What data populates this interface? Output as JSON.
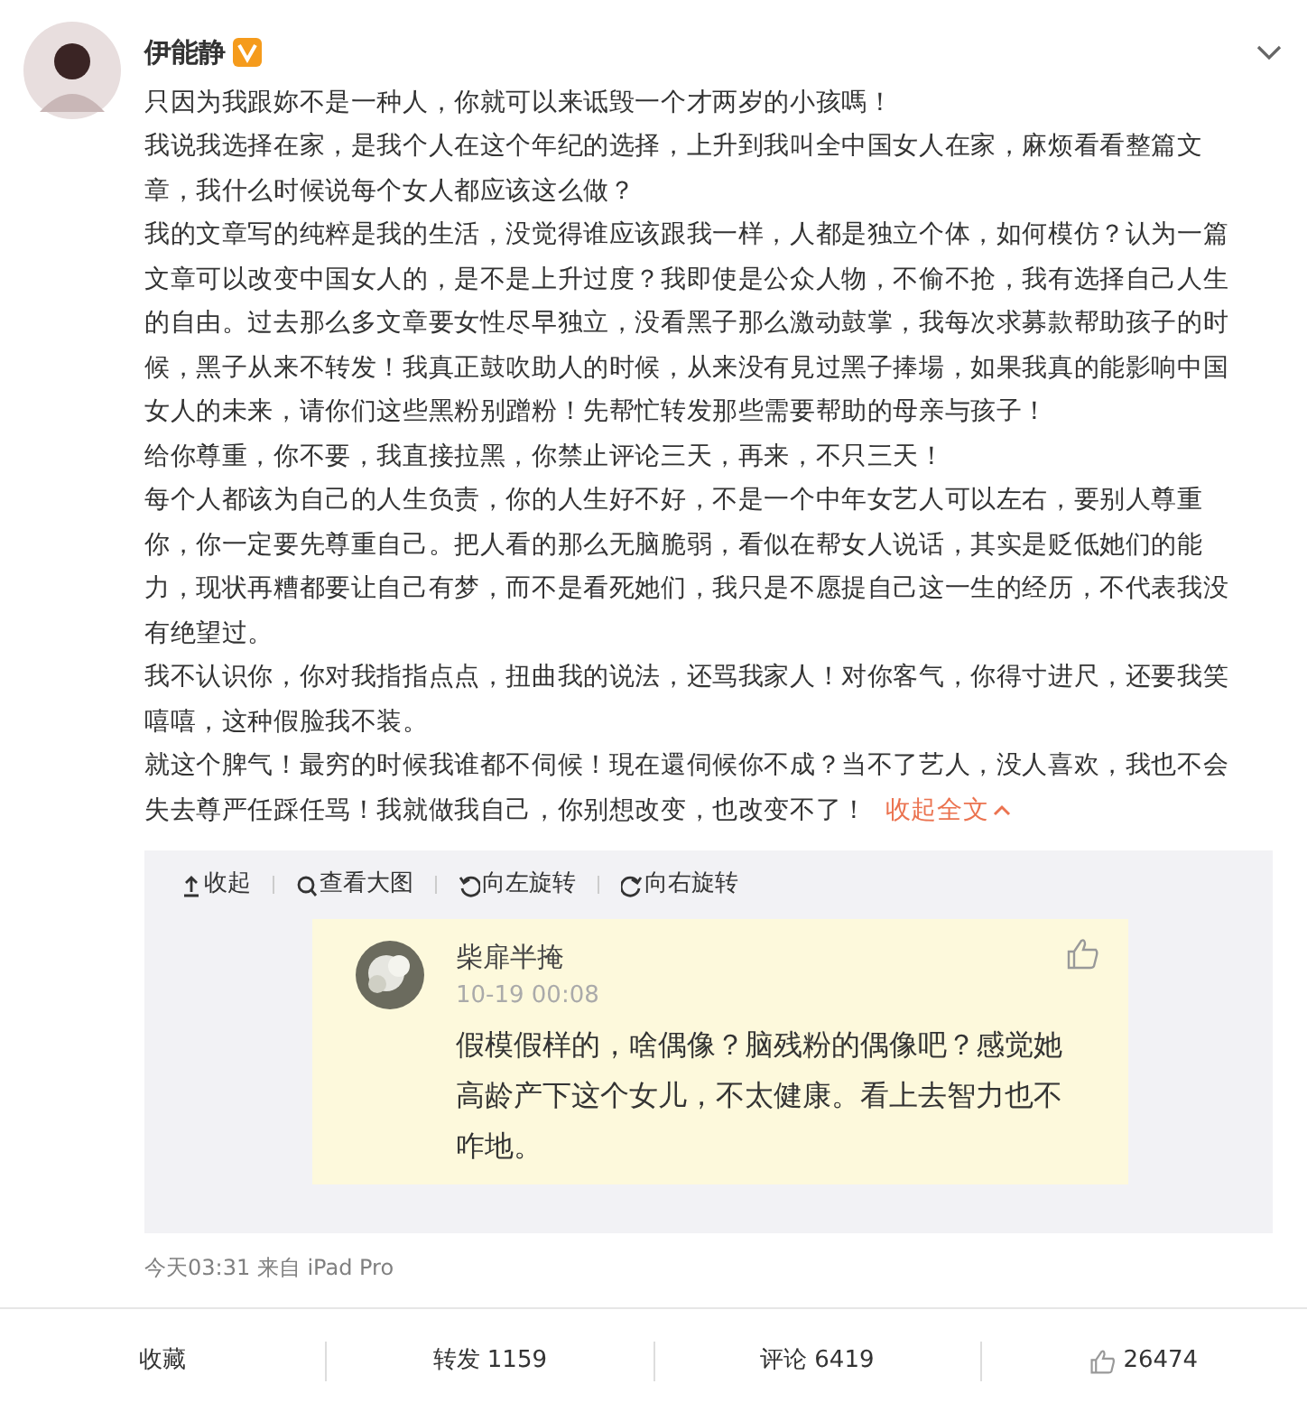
{
  "author": {
    "name": "伊能静",
    "verified": true
  },
  "paragraphs": [
    "只因为我跟妳不是一种人，你就可以来诋毁一个才两岁的小孩嗎！",
    "我说我选择在家，是我个人在这个年纪的选择，上升到我叫全中国女人在家，麻烦看看整篇文章，我什么时候说每个女人都应该这么做？",
    "我的文章写的纯粹是我的生活，没觉得谁应该跟我一样，人都是独立个体，如何模仿？认为一篇文章可以改变中国女人的，是不是上升过度？我即使是公众人物，不偷不抢，我有选择自己人生的自由。过去那么多文章要女性尽早独立，没看黑子那么激动鼓掌，我每次求募款帮助孩子的时候，黑子从来不转发！我真正鼓吹助人的时候，从来没有見过黑子捧場，如果我真的能影响中国女人的未来，请你们这些黑粉别蹭粉！先帮忙转发那些需要帮助的母亲与孩子！",
    "给你尊重，你不要，我直接拉黑，你禁止评论三天，再来，不只三天！",
    "每个人都该为自己的人生负责，你的人生好不好，不是一个中年女艺人可以左右，要别人尊重你，你一定要先尊重自己。把人看的那么无脑脆弱，看似在帮女人说话，其实是贬低她们的能力，现状再糟都要让自己有梦，而不是看死她们，我只是不愿提自己这一生的经历，不代表我没有绝望过。",
    "我不认识你，你对我指指点点，扭曲我的说法，还骂我家人！对你客气，你得寸进尺，还要我笑嘻嘻，这种假脸我不装。",
    "就这个脾气！最穷的时候我谁都不伺候！現在還伺候你不成？当不了艺人，没人喜欢，我也不会失去尊严任踩任骂！我就做我自己，你别想改变，也改变不了！"
  ],
  "collapse_link": "收起全文",
  "media_toolbar": [
    {
      "kind": "collapse",
      "label": "收起"
    },
    {
      "kind": "zoom",
      "label": "查看大图"
    },
    {
      "kind": "rotate-left",
      "label": "向左旋转"
    },
    {
      "kind": "rotate-right",
      "label": "向右旋转"
    }
  ],
  "embedded_comment": {
    "user": "柴扉半掩",
    "time": "10-19 00:08",
    "text": "假模假样的，啥偶像？脑残粉的偶像吧？感觉她高龄产下这个女儿，不太健康。看上去智力也不咋地。"
  },
  "meta": "今天03:31 来自 iPad Pro",
  "actions": [
    {
      "kind": "favorite",
      "label": "收藏"
    },
    {
      "kind": "repost",
      "label": "转发 1159"
    },
    {
      "kind": "comment",
      "label": "评论 6419"
    },
    {
      "kind": "like",
      "label": "26474"
    }
  ]
}
